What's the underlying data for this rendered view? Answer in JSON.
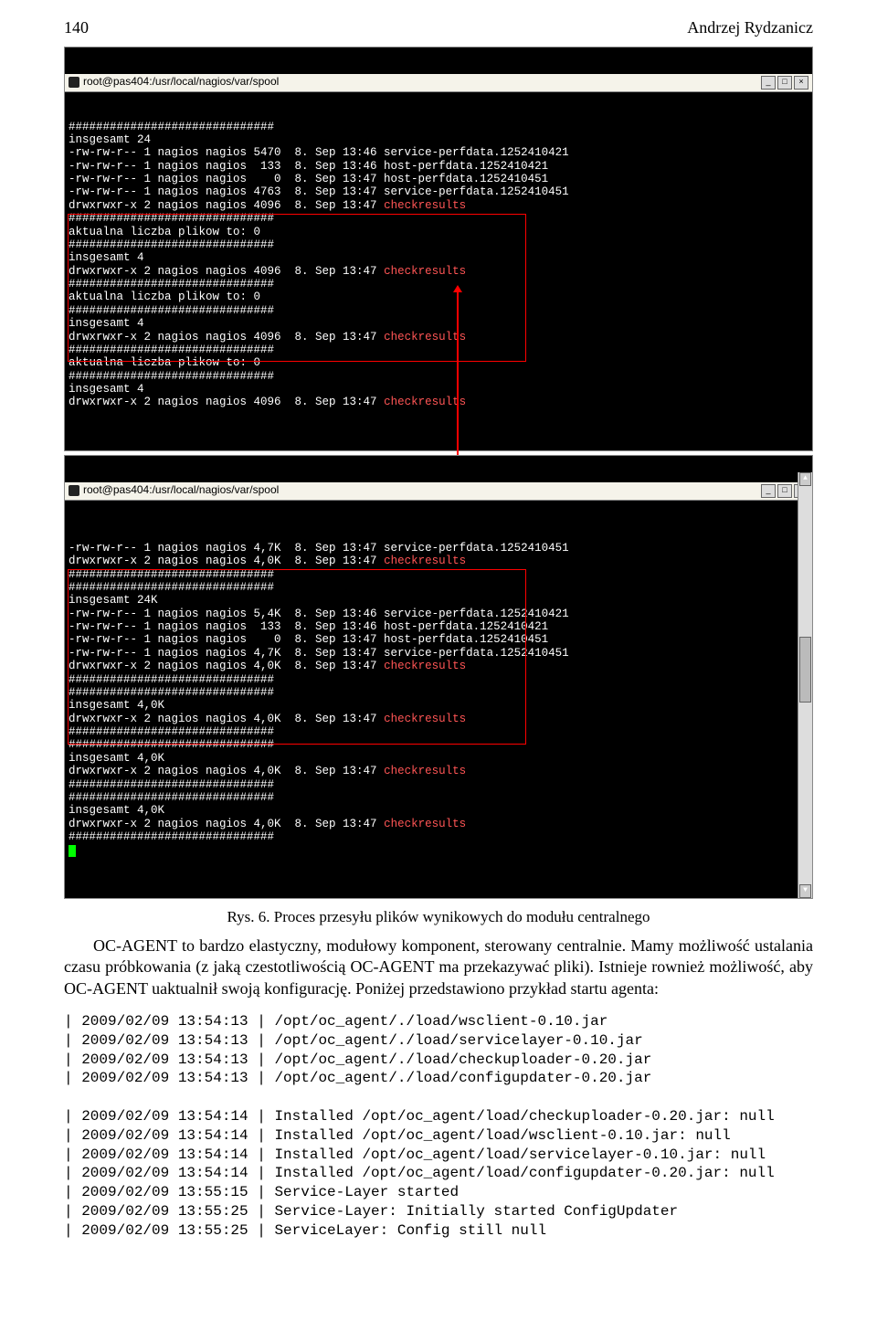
{
  "header": {
    "page_number": "140",
    "author": "Andrzej Rydzanicz"
  },
  "terminal1": {
    "title": "root@pas404:/usr/local/nagios/var/spool",
    "lines_plain": "##############################\ninsgesamt 24\n-rw-rw-r-- 1 nagios nagios 5470  8. Sep 13:46 service-perfdata.1252410421\n-rw-rw-r-- 1 nagios nagios  133  8. Sep 13:46 host-perfdata.1252410421\n-rw-rw-r-- 1 nagios nagios    0  8. Sep 13:47 host-perfdata.1252410451\n-rw-rw-r-- 1 nagios nagios 4763  8. Sep 13:47 service-perfdata.1252410451",
    "line_chk1": "drwxrwxr-x 2 nagios nagios 4096  8. Sep 13:47 ",
    "lines_mid": "##############################\naktualna liczba plikow to: 0\n##############################\ninsgesamt 4",
    "line_chk2": "drwxrwxr-x 2 nagios nagios 4096  8. Sep 13:47 ",
    "lines_mid2": "##############################\naktualna liczba plikow to: 0\n##############################\ninsgesamt 4",
    "line_chk3": "drwxrwxr-x 2 nagios nagios 4096  8. Sep 13:47 ",
    "lines_mid3": "##############################\naktualna liczba plikow to: 0\n##############################\ninsgesamt 4",
    "line_chk4": "drwxrwxr-x 2 nagios nagios 4096  8. Sep 13:47 ",
    "checkresults": "checkresults"
  },
  "terminal2": {
    "title": "root@pas404:/usr/local/nagios/var/spool",
    "lines_top": "-rw-rw-r-- 1 nagios nagios 4,7K  8. Sep 13:47 service-perfdata.1252410451",
    "line_chk1": "drwxrwxr-x 2 nagios nagios 4,0K  8. Sep 13:47 ",
    "lines_mid": "##############################\n##############################\ninsgesamt 24K\n-rw-rw-r-- 1 nagios nagios 5,4K  8. Sep 13:46 service-perfdata.1252410421\n-rw-rw-r-- 1 nagios nagios  133  8. Sep 13:46 host-perfdata.1252410421\n-rw-rw-r-- 1 nagios nagios    0  8. Sep 13:47 host-perfdata.1252410451\n-rw-rw-r-- 1 nagios nagios 4,7K  8. Sep 13:47 service-perfdata.1252410451",
    "line_chk2": "drwxrwxr-x 2 nagios nagios 4,0K  8. Sep 13:47 ",
    "lines_mid2": "##############################\n##############################\ninsgesamt 4,0K",
    "line_chk3": "drwxrwxr-x 2 nagios nagios 4,0K  8. Sep 13:47 ",
    "lines_mid3": "##############################\n##############################\ninsgesamt 4,0K",
    "line_chk4": "drwxrwxr-x 2 nagios nagios 4,0K  8. Sep 13:47 ",
    "lines_mid4": "##############################\n##############################\ninsgesamt 4,0K",
    "line_chk5": "drwxrwxr-x 2 nagios nagios 4,0K  8. Sep 13:47 ",
    "lines_end": "##############################",
    "checkresults": "checkresults"
  },
  "caption": "Rys. 6. Proces przesyłu plików wynikowych do modułu centralnego",
  "body": "OC-AGENT to bardzo elastyczny, modułowy komponent, sterowany centralnie. Mamy możliwość ustalania czasu próbkowania (z jaką czestotliwością OC-AGENT ma przekazywać pliki). Istnieje rownież możliwość, aby OC-AGENT uaktualnił swoją konfigurację. Poniżej przedstawiono przykład startu agenta:",
  "log": "| 2009/02/09 13:54:13 | /opt/oc_agent/./load/wsclient-0.10.jar\n| 2009/02/09 13:54:13 | /opt/oc_agent/./load/servicelayer-0.10.jar\n| 2009/02/09 13:54:13 | /opt/oc_agent/./load/checkuploader-0.20.jar\n| 2009/02/09 13:54:13 | /opt/oc_agent/./load/configupdater-0.20.jar\n\n| 2009/02/09 13:54:14 | Installed /opt/oc_agent/load/checkuploader-0.20.jar: null\n| 2009/02/09 13:54:14 | Installed /opt/oc_agent/load/wsclient-0.10.jar: null\n| 2009/02/09 13:54:14 | Installed /opt/oc_agent/load/servicelayer-0.10.jar: null\n| 2009/02/09 13:54:14 | Installed /opt/oc_agent/load/configupdater-0.20.jar: null\n| 2009/02/09 13:55:15 | Service-Layer started\n| 2009/02/09 13:55:25 | Service-Layer: Initially started ConfigUpdater\n| 2009/02/09 13:55:25 | ServiceLayer: Config still null"
}
